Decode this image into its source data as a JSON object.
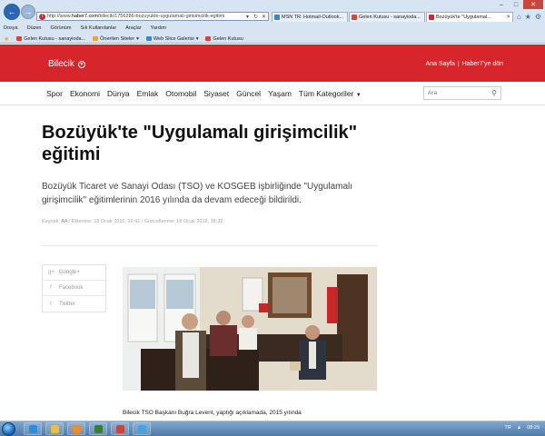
{
  "browser": {
    "address_url_prefix": "http://www.",
    "address_url_domain": "haber7.com",
    "address_url_path": "/bilecik/1756286-bozuyukte-uygulamali-girisimcilik-egitimi",
    "tabs": [
      {
        "title": "MSN TR: Hotmail-Outlook...",
        "color": "#3a86c8"
      },
      {
        "title": "Gelen Kutusu - sanayioda...",
        "color": "#d44638"
      },
      {
        "title": "Bozüyük'te \"Uygulamal...",
        "color": "#d6262c",
        "active": true
      }
    ],
    "menu": [
      "Dosya",
      "Düzen",
      "Görünüm",
      "Sık Kullanılanlar",
      "Araçlar",
      "Yardım"
    ],
    "favorites": [
      {
        "label": "Gelen Kutusu - sanayioda...",
        "color": "#d44638"
      },
      {
        "label": "Önerilen Siteler",
        "color": "#e8a33c"
      },
      {
        "label": "Web Slice Galerisi",
        "color": "#3a86c8"
      },
      {
        "label": "Gelen Kutusu",
        "color": "#d44638"
      }
    ]
  },
  "header": {
    "brand": "Bilecik",
    "links": [
      "Ana Sayfa",
      "|",
      "Haber7'ye dön"
    ]
  },
  "nav": {
    "items": [
      "Spor",
      "Ekonomi",
      "Dünya",
      "Emlak",
      "Otomobil",
      "Siyaset",
      "Güncel",
      "Yaşam"
    ],
    "all_categories": "Tüm Kategoriler",
    "search_placeholder": "Ara"
  },
  "article": {
    "title": "Bozüyük'te \"Uygulamalı girişimcilik\" eğitimi",
    "summary": "Bozüyük Ticaret ve Sanayi Odası (TSO) ve KOSGEB işbirliğinde \"Uygulamalı girişimcilik\" eğitimlerinin 2016 yılında da devam edeceği bildirildi.",
    "meta_source_label": "Kaynak:",
    "meta_source": "AA",
    "meta_dates": "/ Eklenme: 18 Ocak 2016, 16:41 / Güncellenme: 18 Ocak 2016, 18:32",
    "body_first_line": "Bilecik TSO Başkanı Buğra Levent, yaptığı açıklamada, 2015 yılında"
  },
  "share": [
    {
      "icon": "g+",
      "label": "Google+"
    },
    {
      "icon": "f",
      "label": "Facebook"
    },
    {
      "icon": "t",
      "label": "Twitter"
    }
  ],
  "taskbar": {
    "language": "TR",
    "clock": "08:29"
  },
  "colors": {
    "brand_red": "#d6262c"
  }
}
